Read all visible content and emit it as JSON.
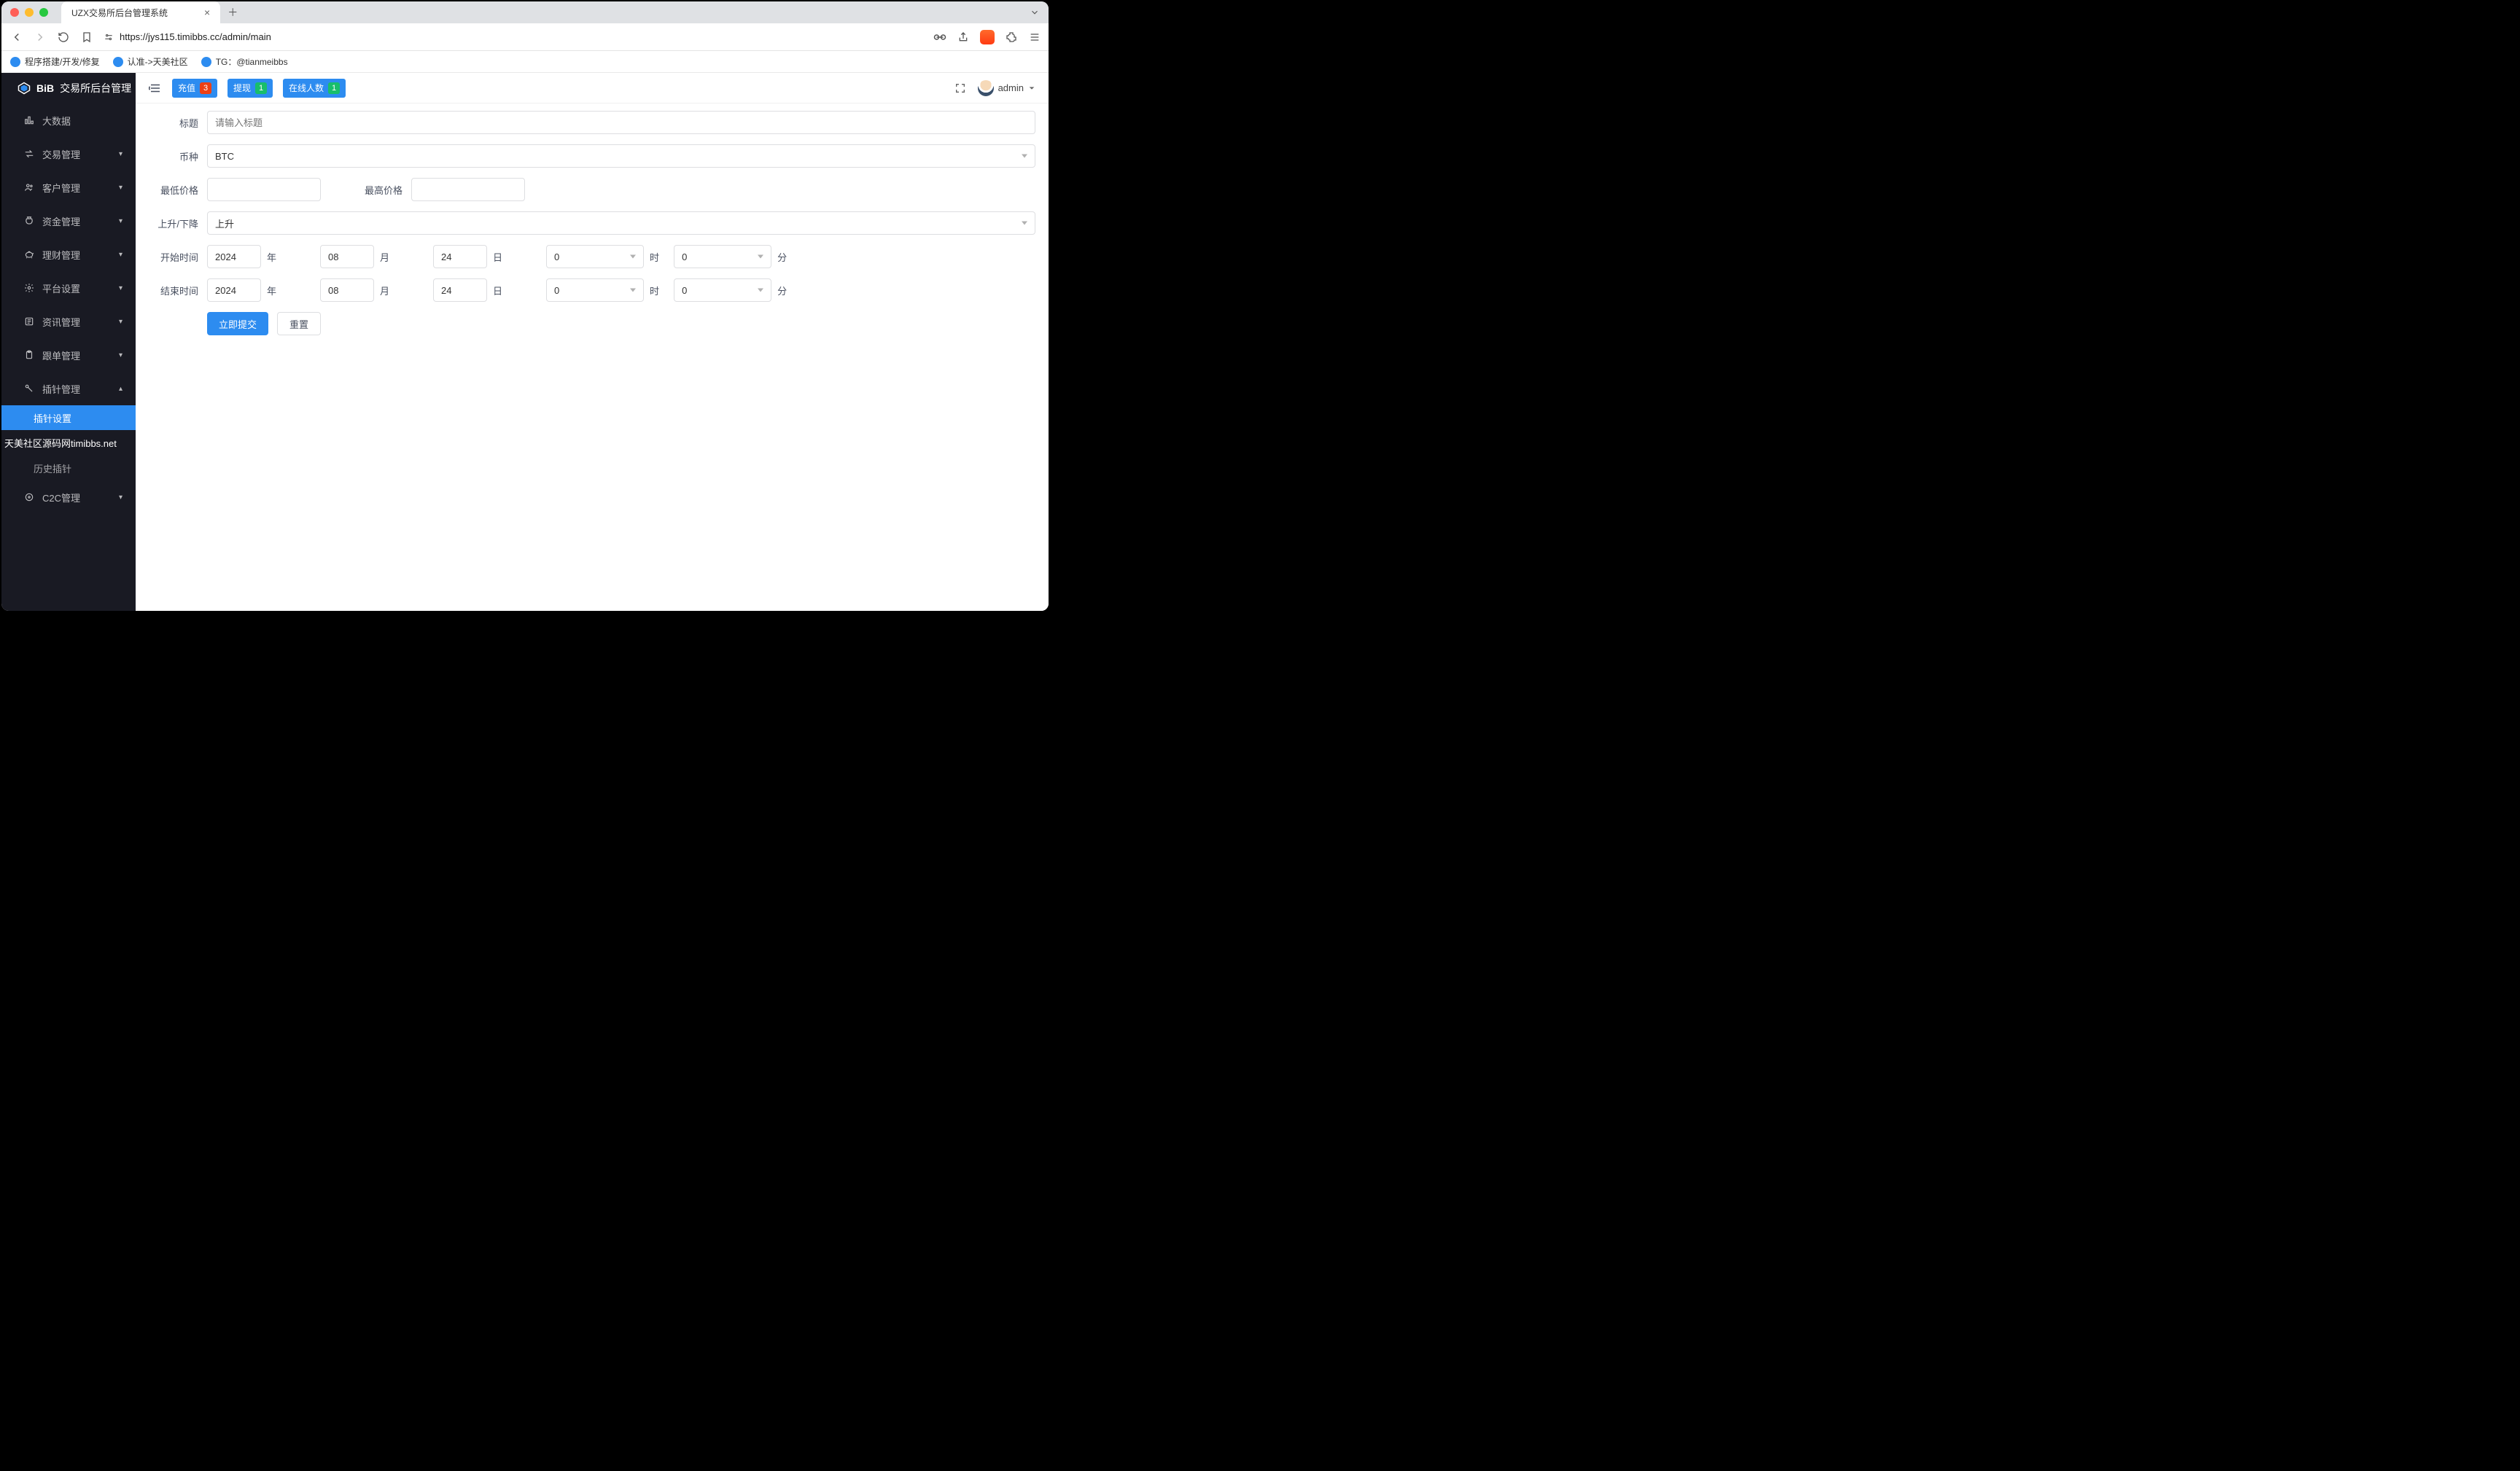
{
  "browser": {
    "tab_title": "UZX交易所后台管理系统",
    "url": "https://jys115.timibbs.cc/admin/main"
  },
  "bookmarks": [
    {
      "label": "程序搭建/开发/修复"
    },
    {
      "label": "认准->天美社区"
    },
    {
      "label": "TG：@tianmeibbs"
    }
  ],
  "sidebar": {
    "title": "交易所后台管理",
    "items": [
      {
        "label": "大数据",
        "caret": ""
      },
      {
        "label": "交易管理",
        "caret": "▾"
      },
      {
        "label": "客户管理",
        "caret": "▾"
      },
      {
        "label": "资金管理",
        "caret": "▾"
      },
      {
        "label": "理财管理",
        "caret": "▾"
      },
      {
        "label": "平台设置",
        "caret": "▾"
      },
      {
        "label": "资讯管理",
        "caret": "▾"
      },
      {
        "label": "跟单管理",
        "caret": "▾"
      }
    ],
    "pin_manage": {
      "label": "插针管理",
      "caret": "▴"
    },
    "pin_sub": [
      {
        "label": "插针设置",
        "active": true
      },
      {
        "label": "历史插针",
        "active": false
      }
    ],
    "c2c": {
      "label": "C2C管理",
      "caret": "▾"
    },
    "watermark": "天美社区源码网timibbs.net"
  },
  "topbar": {
    "pills": [
      {
        "label": "充值",
        "badge": "3",
        "badge_class": "red"
      },
      {
        "label": "提现",
        "badge": "1",
        "badge_class": "green"
      },
      {
        "label": "在线人数",
        "badge": "1",
        "badge_class": "green"
      }
    ],
    "user": "admin"
  },
  "form": {
    "title": {
      "label": "标题",
      "placeholder": "请输入标题",
      "value": ""
    },
    "coin": {
      "label": "币种",
      "value": "BTC"
    },
    "low": {
      "label": "最低价格",
      "value": ""
    },
    "high": {
      "label": "最高价格",
      "value": ""
    },
    "direction": {
      "label": "上升/下降",
      "value": "上升"
    },
    "start": {
      "label": "开始时间",
      "year": "2024",
      "month": "08",
      "day": "24",
      "hour": "0",
      "minute": "0"
    },
    "end": {
      "label": "结束时间",
      "year": "2024",
      "month": "08",
      "day": "24",
      "hour": "0",
      "minute": "0"
    },
    "time_units": {
      "year": "年",
      "month": "月",
      "day": "日",
      "hour": "时",
      "minute": "分"
    },
    "submit": "立即提交",
    "reset": "重置"
  }
}
